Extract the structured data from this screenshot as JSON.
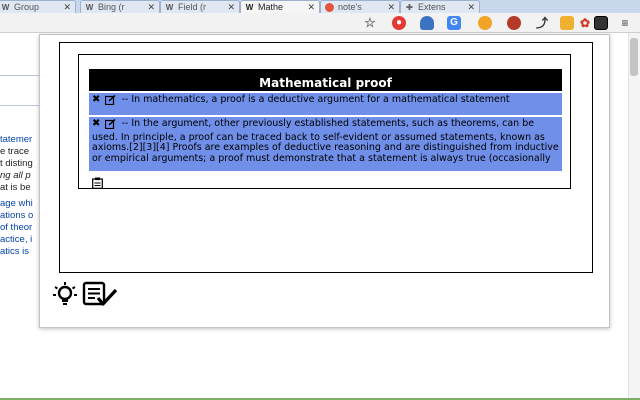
{
  "browser": {
    "tabs": [
      {
        "title": "Group",
        "favicon": "W",
        "active": false
      },
      {
        "title": "Bing (r",
        "favicon": "W",
        "active": false
      },
      {
        "title": "Field (r",
        "favicon": "W",
        "active": false
      },
      {
        "title": "Mathe",
        "favicon": "W",
        "active": true
      },
      {
        "title": "note's",
        "favicon": "app-icon",
        "active": false
      },
      {
        "title": "Extens",
        "favicon": "puzzle-icon",
        "active": false
      }
    ],
    "toolbar_icons": [
      "star-icon",
      "record-icon",
      "ghost-icon",
      "translate-icon",
      "color-icon",
      "fruit-icon",
      "share-icon",
      "pin-icon",
      "gift-icon",
      "facebook-icon",
      "notes-extension-icon",
      "menu-icon"
    ]
  },
  "page_fragments": [
    "tatemer",
    "e trace",
    "t disting",
    "ng all p",
    "at is be",
    "age whi",
    "ations o",
    "of theor",
    "actice, i",
    "atics is"
  ],
  "popup": {
    "title": "Mathematical proof",
    "notes": [
      {
        "text": "-- In mathematics, a proof is a deductive argument for a mathematical statement"
      },
      {
        "text": "-- In the argument, other previously established statements, such as theorems, can be used. In principle, a proof can be traced back to self-evident or assumed statements, known as axioms.[2][3][4] Proofs are examples of deductive reasoning and are distinguished from inductive or empirical arguments; a proof must demonstrate that a statement is always true (occasionally"
      }
    ]
  },
  "colors": {
    "note_bg": "#6f8fe8",
    "title_bg": "#000000",
    "tabstrip_bg": "#c9d7ec"
  }
}
